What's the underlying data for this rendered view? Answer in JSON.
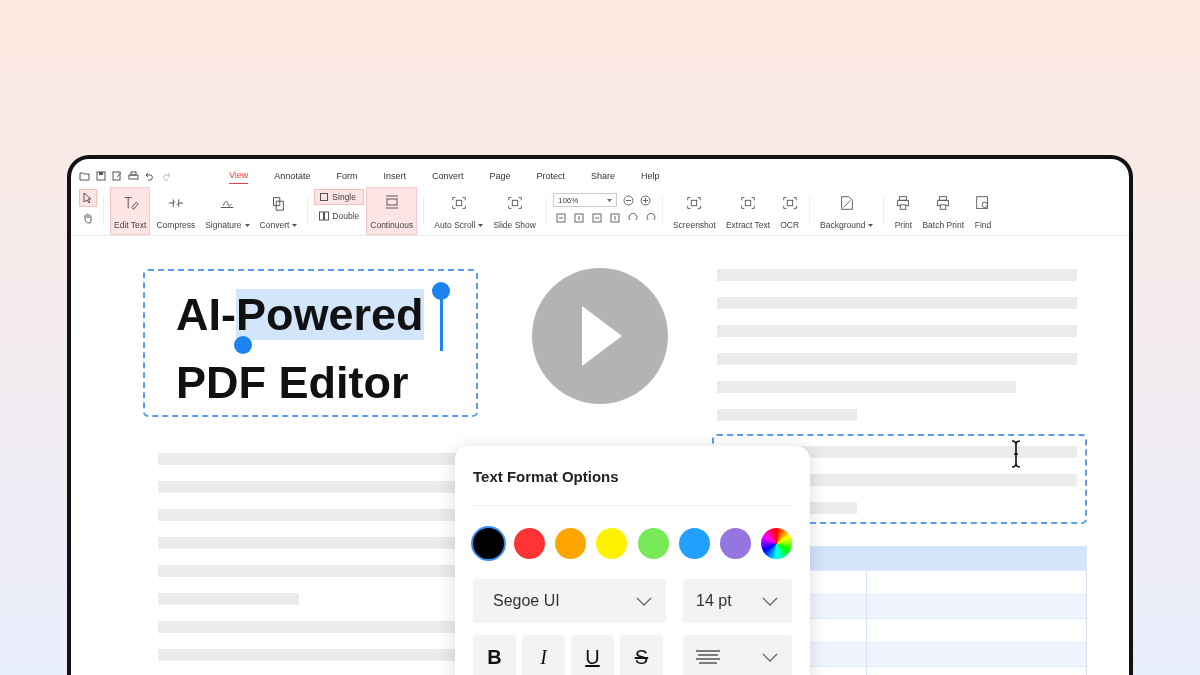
{
  "menu_tabs": [
    {
      "label": "View",
      "selected": true
    },
    {
      "label": "Annotate",
      "selected": false
    },
    {
      "label": "Form",
      "selected": false
    },
    {
      "label": "Insert",
      "selected": false
    },
    {
      "label": "Convert",
      "selected": false
    },
    {
      "label": "Page",
      "selected": false
    },
    {
      "label": "Protect",
      "selected": false
    },
    {
      "label": "Share",
      "selected": false
    },
    {
      "label": "Help",
      "selected": false
    }
  ],
  "pointer_tools": [
    {
      "selected": true
    },
    {
      "selected": false
    }
  ],
  "toolbar_groups": [
    [
      {
        "label": "Edit Text",
        "dropdown": false,
        "selected": true
      },
      {
        "label": "Compress",
        "dropdown": false,
        "selected": false
      },
      {
        "label": "Signature",
        "dropdown": true,
        "selected": false
      },
      {
        "label": "Convert",
        "dropdown": true,
        "selected": false
      }
    ],
    [
      {
        "label": "Single",
        "kind": "small",
        "selected": true
      },
      {
        "label": "Double",
        "kind": "small",
        "selected": false
      },
      {
        "label": "Continuous",
        "kind": "big",
        "selected": true
      }
    ],
    [
      {
        "label": "Auto Scroll",
        "dropdown": true,
        "selected": false
      },
      {
        "label": "Slide Show",
        "dropdown": false,
        "selected": false
      }
    ],
    [
      {
        "label": "106%",
        "kind": "zoom"
      }
    ],
    [
      {
        "label": "Screenshot",
        "dropdown": false,
        "selected": false
      },
      {
        "label": "Extract Text",
        "dropdown": false,
        "selected": false
      },
      {
        "label": "OCR",
        "dropdown": false,
        "selected": false
      }
    ],
    [
      {
        "label": "Background",
        "dropdown": true,
        "selected": false
      }
    ],
    [
      {
        "label": "Print",
        "dropdown": false,
        "selected": false
      },
      {
        "label": "Batch Print",
        "dropdown": false,
        "selected": false
      },
      {
        "label": "Find",
        "dropdown": false,
        "selected": false
      }
    ]
  ],
  "heading": {
    "line_1": [
      {
        "text": "AI-",
        "selected": false
      },
      {
        "text": "Powered",
        "selected": true
      }
    ],
    "line_2": "PDF Editor"
  },
  "text_format": {
    "title": "Text Format Options",
    "swatches": [
      {
        "color": "#000000",
        "selected": true
      },
      {
        "color": "#ff3333",
        "selected": false
      },
      {
        "color": "#ffa500",
        "selected": false
      },
      {
        "color": "#fff200",
        "selected": false
      },
      {
        "color": "#77e856",
        "selected": false
      },
      {
        "color": "#22a0ff",
        "selected": false
      },
      {
        "color": "#9575e0",
        "selected": false
      },
      {
        "kind": "spectrum",
        "selected": false
      }
    ],
    "font": "Segoe UI",
    "size": "14 pt",
    "styles": [
      {
        "label": "B",
        "kind": "bold"
      },
      {
        "label": "I",
        "kind": "italic"
      },
      {
        "label": "U",
        "kind": "underline"
      },
      {
        "label": "S",
        "kind": "strike"
      }
    ]
  }
}
